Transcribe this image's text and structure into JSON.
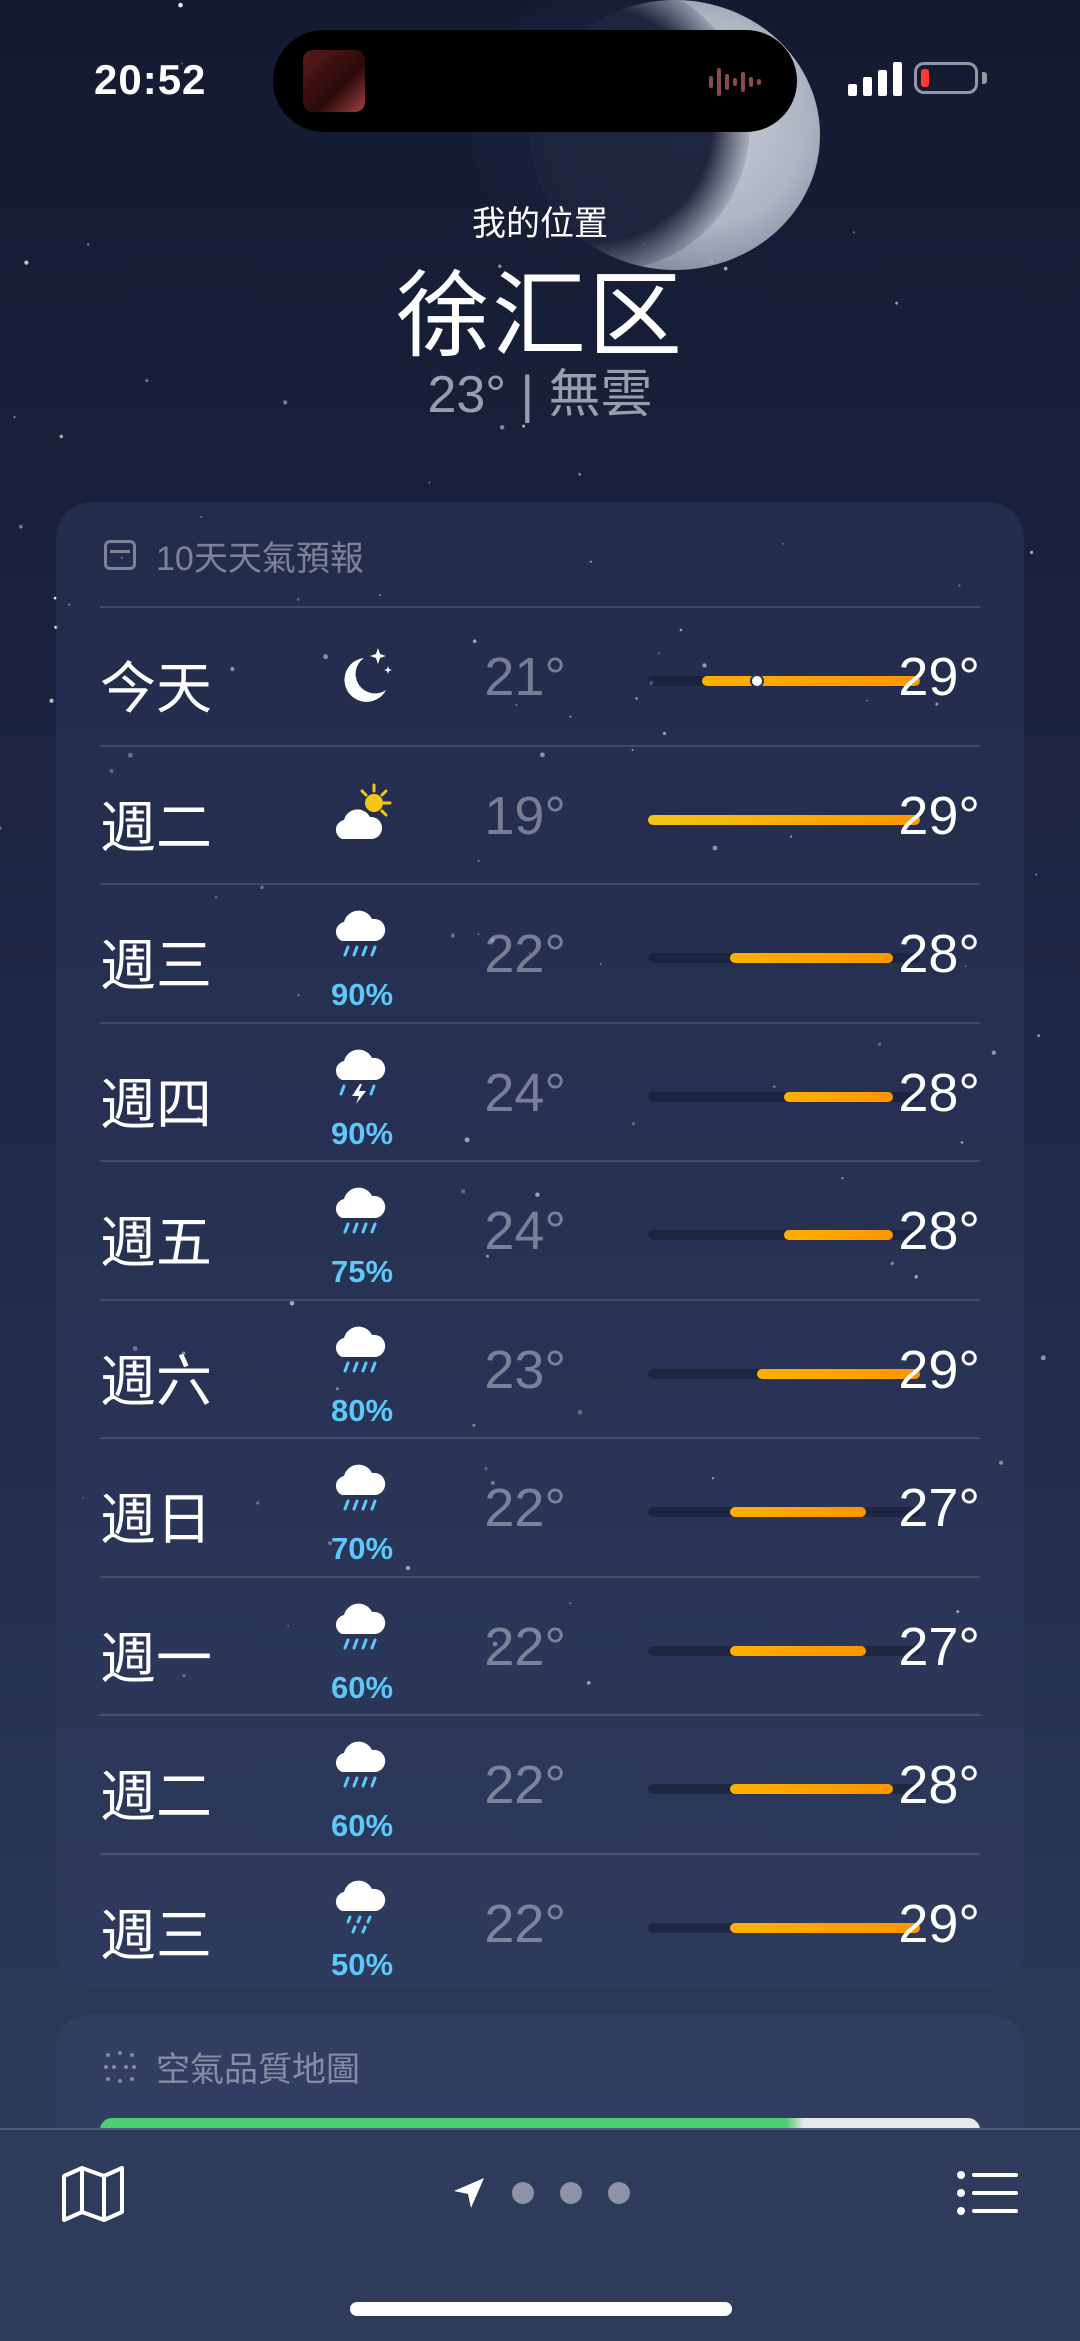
{
  "status_bar": {
    "time": "20:52"
  },
  "header": {
    "location_label": "我的位置",
    "city": "徐汇区",
    "current_summary": "23° | 無雲"
  },
  "forecast": {
    "title": "10天天氣預報",
    "scale_min": 19,
    "scale_max": 29,
    "current_temp": 23,
    "days": [
      {
        "day": "今天",
        "icon": "moon-stars-icon",
        "precip": "",
        "low": "21°",
        "high": "29°",
        "low_val": 21,
        "high_val": 29
      },
      {
        "day": "週二",
        "icon": "partly-sunny-icon",
        "precip": "",
        "low": "19°",
        "high": "29°",
        "low_val": 19,
        "high_val": 29
      },
      {
        "day": "週三",
        "icon": "rain-cloud-icon",
        "precip": "90%",
        "low": "22°",
        "high": "28°",
        "low_val": 22,
        "high_val": 28
      },
      {
        "day": "週四",
        "icon": "thunderstorm-icon",
        "precip": "90%",
        "low": "24°",
        "high": "28°",
        "low_val": 24,
        "high_val": 28
      },
      {
        "day": "週五",
        "icon": "rain-cloud-icon",
        "precip": "75%",
        "low": "24°",
        "high": "28°",
        "low_val": 24,
        "high_val": 28
      },
      {
        "day": "週六",
        "icon": "rain-cloud-icon",
        "precip": "80%",
        "low": "23°",
        "high": "29°",
        "low_val": 23,
        "high_val": 29
      },
      {
        "day": "週日",
        "icon": "rain-cloud-icon",
        "precip": "70%",
        "low": "22°",
        "high": "27°",
        "low_val": 22,
        "high_val": 27
      },
      {
        "day": "週一",
        "icon": "rain-cloud-icon",
        "precip": "60%",
        "low": "22°",
        "high": "27°",
        "low_val": 22,
        "high_val": 27
      },
      {
        "day": "週二",
        "icon": "rain-cloud-icon",
        "precip": "60%",
        "low": "22°",
        "high": "28°",
        "low_val": 22,
        "high_val": 28
      },
      {
        "day": "週三",
        "icon": "drizzle-cloud-icon",
        "precip": "50%",
        "low": "22°",
        "high": "29°",
        "low_val": 22,
        "high_val": 29
      }
    ]
  },
  "air_quality": {
    "title": "空氣品質地圖"
  },
  "bottom_bar": {
    "map_icon": "map-icon",
    "list_icon": "list-icon",
    "page_count": 3
  },
  "colors": {
    "precip": "#5ec8fa",
    "bar_yellow": "#f5c518",
    "bar_orange": "#ff9500"
  }
}
